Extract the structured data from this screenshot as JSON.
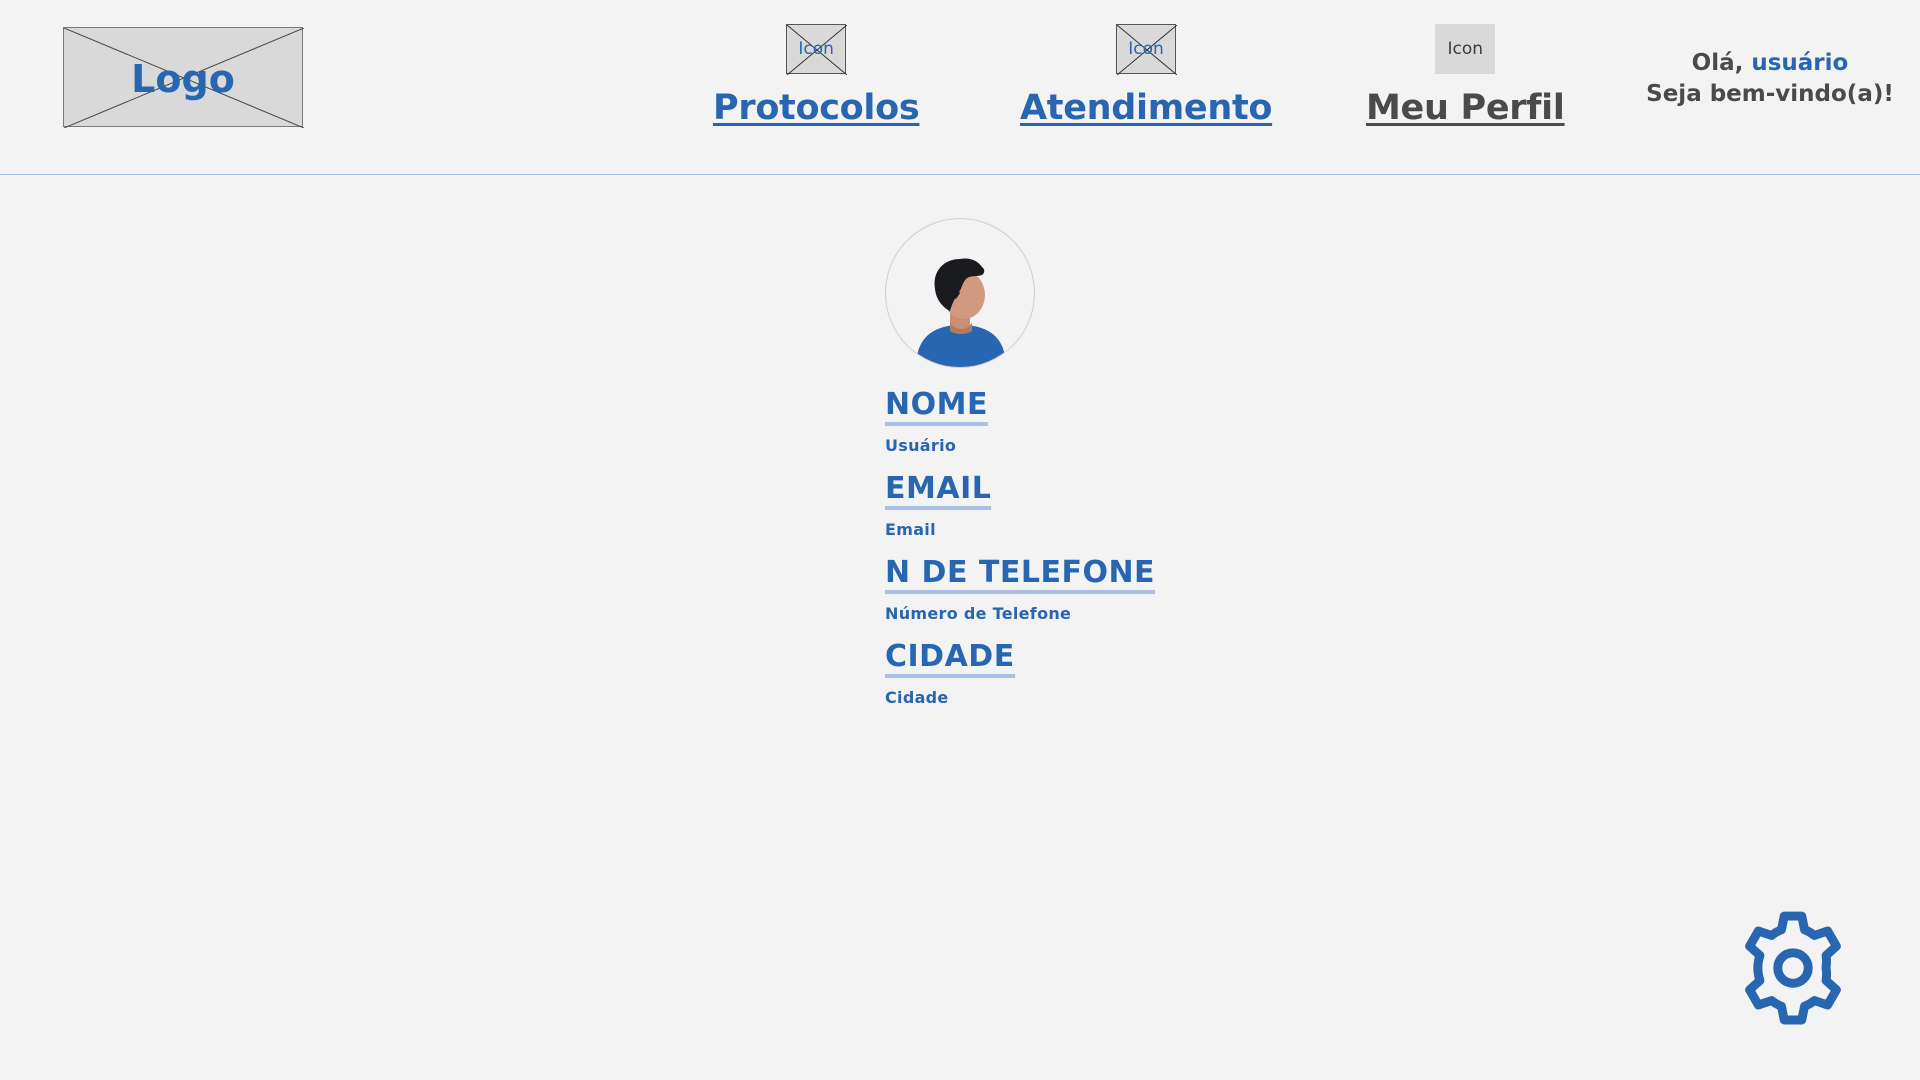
{
  "header": {
    "logo_text": "Logo",
    "nav": [
      {
        "icon_text": "Icon",
        "label": "Protocolos"
      },
      {
        "icon_text": "Icon",
        "label": "Atendimento"
      },
      {
        "icon_text": "Icon",
        "label": "Meu Perfil"
      }
    ],
    "greeting": {
      "hello": "Olá, ",
      "user": "usuário",
      "welcome": "Seja bem-vindo(a)!"
    }
  },
  "profile": {
    "avatar_icon": "user-avatar-icon",
    "fields": [
      {
        "title": "NOME",
        "value": "Usuário"
      },
      {
        "title": "EMAIL",
        "value": "Email"
      },
      {
        "title": "N DE TELEFONE",
        "value": "Número de Telefone"
      },
      {
        "title": "CIDADE",
        "value": "Cidade"
      }
    ]
  },
  "settings": {
    "icon": "gear-icon"
  },
  "colors": {
    "accent": "#2866b1",
    "text_gray": "#4a4a4a",
    "divider": "#a9bfe3",
    "background": "#f3f3f3"
  }
}
